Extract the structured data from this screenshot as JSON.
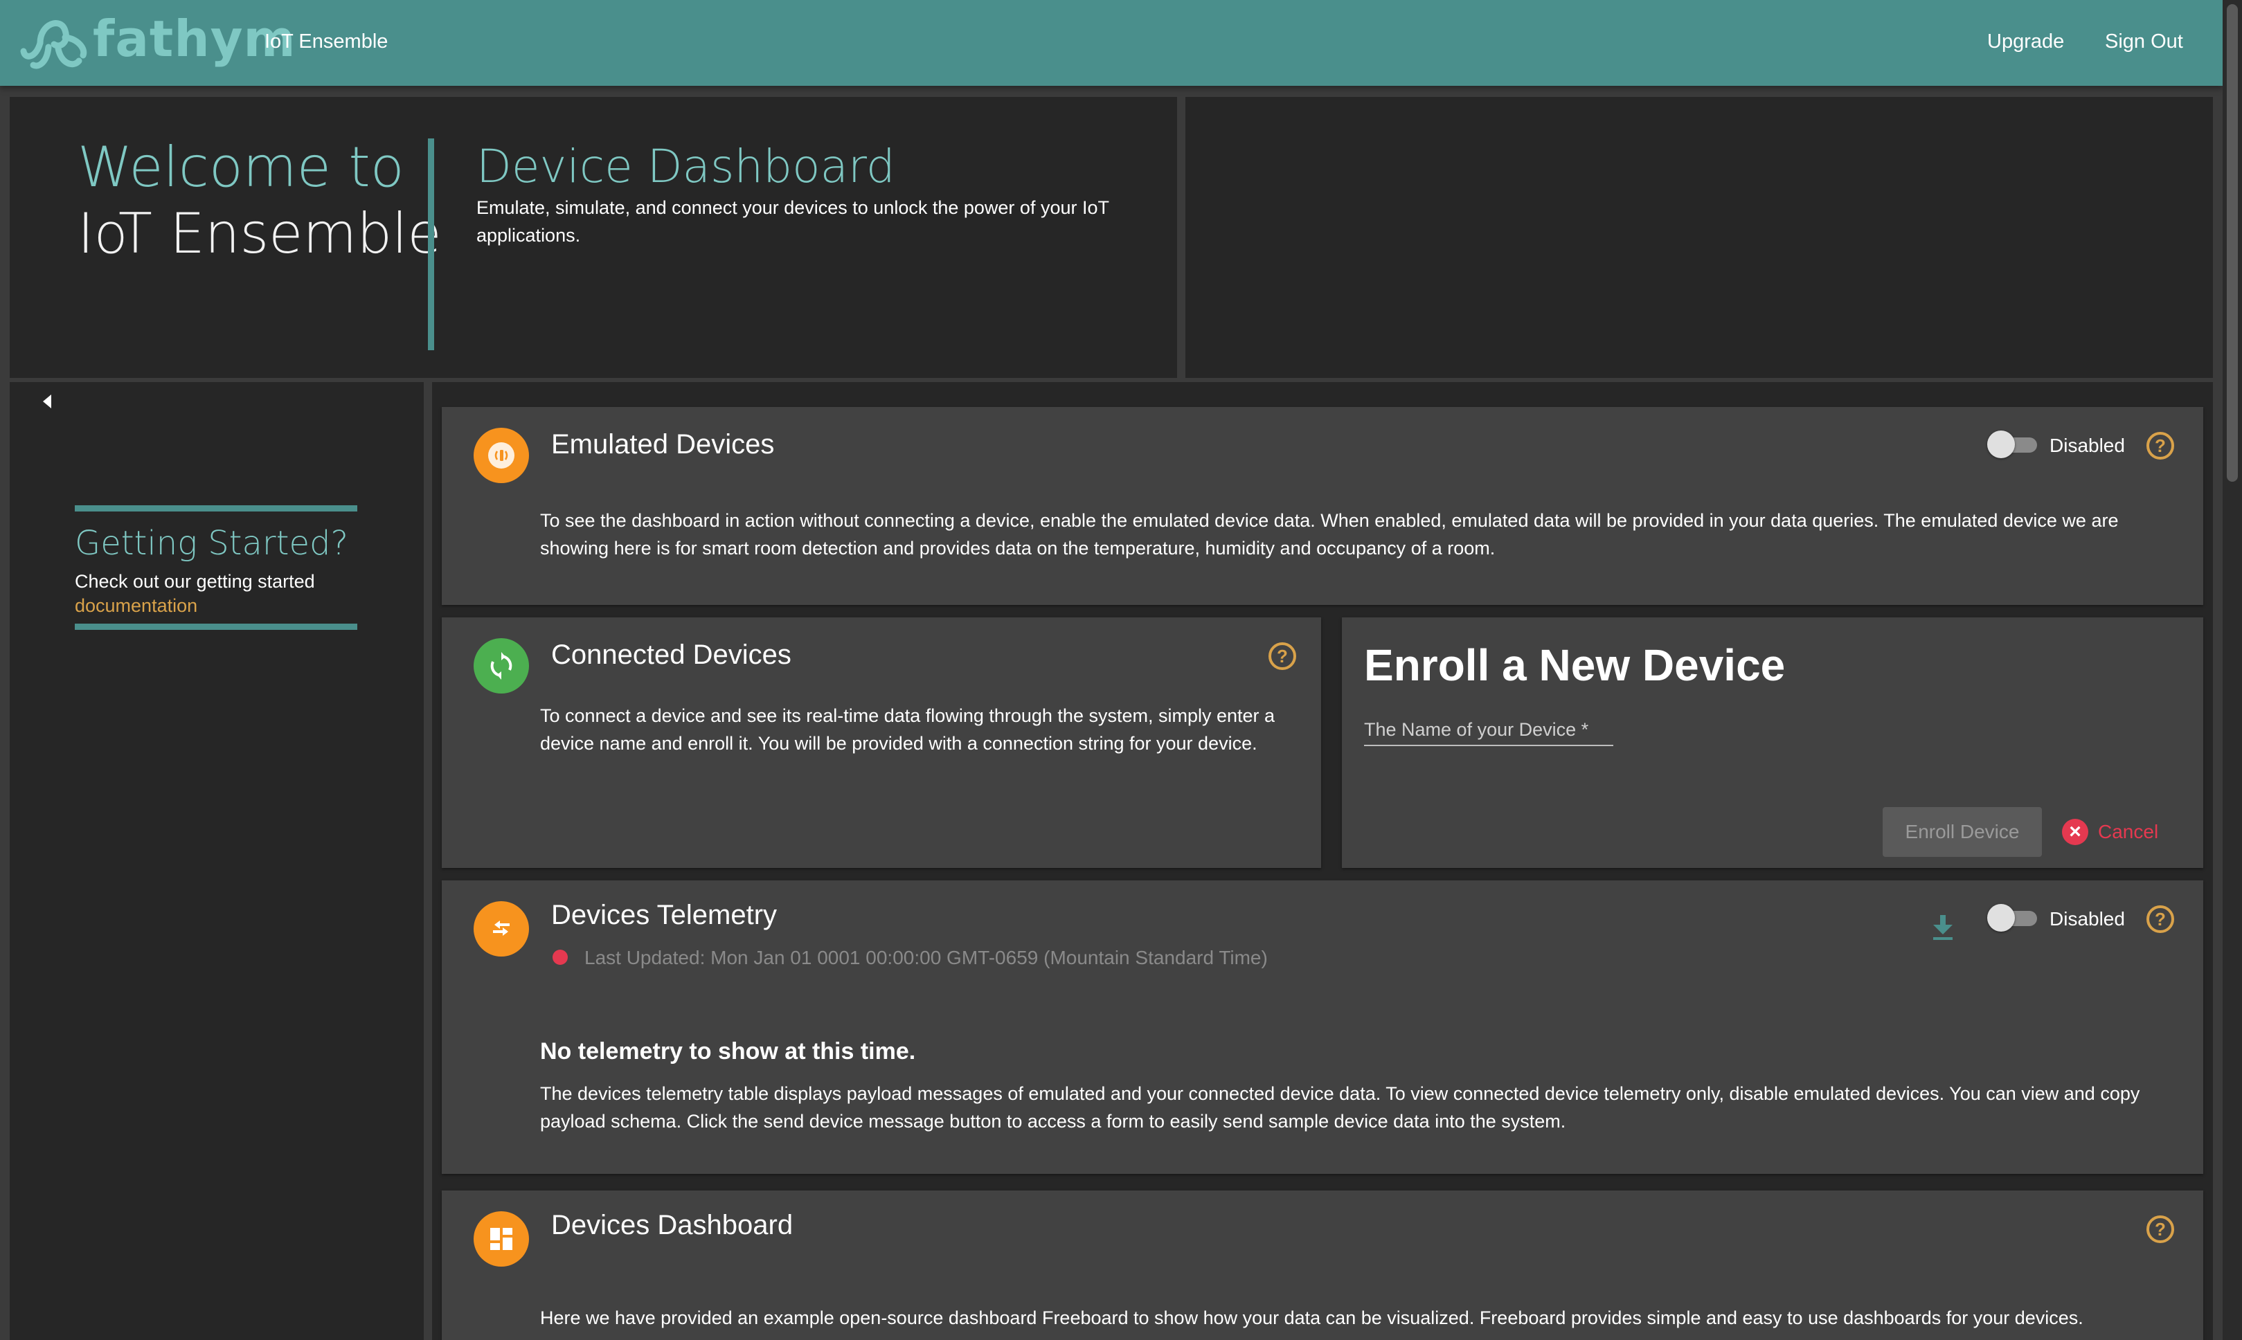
{
  "header": {
    "logo_text": "fathym",
    "app_name": "IoT Ensemble",
    "upgrade_label": "Upgrade",
    "signout_label": "Sign Out"
  },
  "hero": {
    "welcome_line1": "Welcome to",
    "welcome_line2": "IoT Ensemble",
    "title": "Device Dashboard",
    "subtitle": "Emulate, simulate, and connect your devices to unlock the power of your IoT applications."
  },
  "sidebar": {
    "getting_started_title": "Getting Started?",
    "getting_started_text": "Check out our getting started",
    "getting_started_link": "documentation"
  },
  "emulated": {
    "title": "Emulated Devices",
    "toggle_label": "Disabled",
    "toggle_on": false,
    "description": "To see the dashboard in action without connecting a device, enable the emulated device data. When enabled, emulated data will be provided in your data queries. The emulated device we are showing here is for smart room detection and provides data on the temperature, humidity and occupancy of a room."
  },
  "connected": {
    "title": "Connected Devices",
    "description": "To connect a device and see its real-time data flowing through the system, simply enter a device name and enroll it. You will be provided with a connection string for your device."
  },
  "enroll": {
    "title": "Enroll a New Device",
    "input_placeholder": "The Name of your Device *",
    "input_value": "",
    "enroll_button": "Enroll Device",
    "cancel_button": "Cancel"
  },
  "telemetry": {
    "title": "Devices Telemetry",
    "toggle_label": "Disabled",
    "toggle_on": false,
    "last_updated": "Last Updated: Mon Jan 01 0001 00:00:00 GMT-0659 (Mountain Standard Time)",
    "empty_title": "No telemetry to show at this time.",
    "empty_text": "The devices telemetry table displays payload messages of emulated and your connected device data. To view connected device telemetry only, disable emulated devices. You can view and copy payload schema. Click the send device message button to access a form to easily send sample device data into the system."
  },
  "dashboard": {
    "title": "Devices Dashboard",
    "description": "Here we have provided an example open-source dashboard Freeboard to show how your data can be visualized. Freeboard provides simple and easy to use dashboards for your devices."
  },
  "colors": {
    "header_bg": "#4a8f8c",
    "accent_teal": "#7fc8c3",
    "accent_orange": "#f7931e",
    "accent_green": "#4caf50",
    "help_gold": "#d9a24a",
    "danger_red": "#e53950",
    "panel_bg": "#262626",
    "card_bg": "#424242"
  },
  "icons": {
    "help": "?",
    "cancel": "×"
  }
}
